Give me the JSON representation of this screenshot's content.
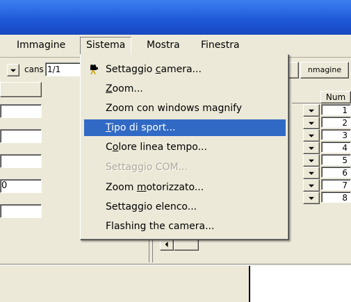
{
  "menubar": {
    "items": [
      "Immagine",
      "Sistema",
      "Mostra",
      "Finestra"
    ],
    "active_index": 1
  },
  "toolbar": {
    "cans_label": "cans",
    "cans_value": "1/1",
    "right_button": "nmagine"
  },
  "left_panel": {
    "field_value": "0"
  },
  "grid": {
    "header": "Num",
    "rows": [
      "1",
      "2",
      "3",
      "4",
      "5",
      "6",
      "7",
      "8"
    ]
  },
  "menu": {
    "items": [
      {
        "label": "Settaggio camera...",
        "mnemonic": "c",
        "icon": "camera-icon",
        "state": "normal"
      },
      {
        "label": "Zoom...",
        "mnemonic": "Z",
        "state": "normal"
      },
      {
        "label": "Zoom con windows magnify",
        "state": "normal"
      },
      {
        "label": "Tipo di sport...",
        "mnemonic": "T",
        "state": "highlighted"
      },
      {
        "label": "Colore linea tempo...",
        "mnemonic": "o",
        "state": "normal"
      },
      {
        "label": "Settaggio COM...",
        "state": "disabled"
      },
      {
        "label": "Zoom motorizzato...",
        "mnemonic": "m",
        "state": "normal"
      },
      {
        "label": "Settaggio elenco...",
        "state": "normal"
      },
      {
        "label": "Flashing the camera...",
        "state": "normal"
      }
    ]
  },
  "colors": {
    "titlebar": "#2a5fd9",
    "highlight": "#316ac5",
    "face": "#ece9d8",
    "disabled_text": "#aca899"
  }
}
